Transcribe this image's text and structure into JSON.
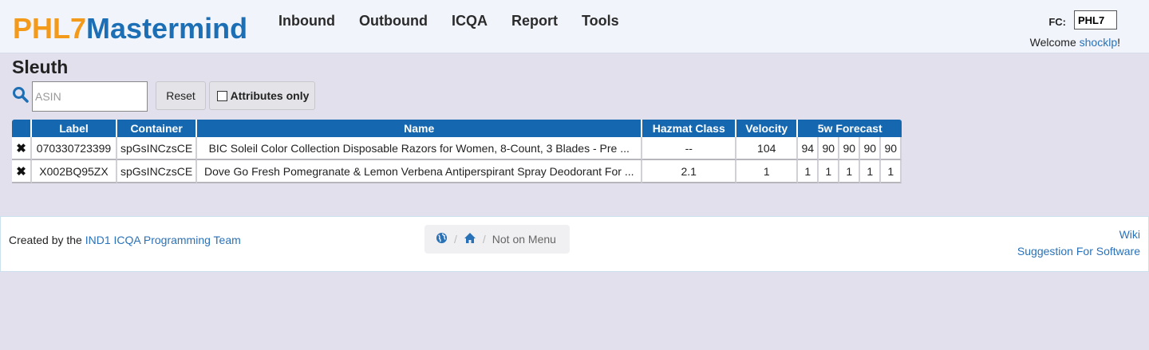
{
  "brand": {
    "part1": "PHL7",
    "part2": "Mastermind"
  },
  "nav": [
    "Inbound",
    "Outbound",
    "ICQA",
    "Report",
    "Tools"
  ],
  "fc": {
    "label": "FC:",
    "value": "PHL7"
  },
  "welcome": {
    "prefix": "Welcome ",
    "user": "shocklp",
    "suffix": "!"
  },
  "page_title": "Sleuth",
  "search": {
    "placeholder": "ASIN",
    "reset_label": "Reset",
    "attributes_label": "Attributes only"
  },
  "table": {
    "headers": {
      "label": "Label",
      "container": "Container",
      "name": "Name",
      "hazmat": "Hazmat Class",
      "velocity": "Velocity",
      "forecast": "5w Forecast"
    },
    "rows": [
      {
        "label": "070330723399",
        "container": "spGsINCzsCE",
        "name": "BIC Soleil Color Collection Disposable Razors for Women, 8-Count, 3 Blades - Pre ...",
        "hazmat": "--",
        "velocity": "104",
        "forecast": [
          "94",
          "90",
          "90",
          "90",
          "90"
        ]
      },
      {
        "label": "X002BQ95ZX",
        "container": "spGsINCzsCE",
        "name": "Dove Go Fresh Pomegranate & Lemon Verbena Antiperspirant Spray Deodorant For ...",
        "hazmat": "2.1",
        "velocity": "1",
        "forecast": [
          "1",
          "1",
          "1",
          "1",
          "1"
        ]
      }
    ]
  },
  "footer": {
    "credit_prefix": "Created by the ",
    "credit_link": "IND1 ICQA Programming Team",
    "breadcrumb_current": "Not on Menu",
    "links": [
      "Wiki",
      "Suggestion For Software"
    ]
  },
  "colors": {
    "brand_orange": "#f39a1b",
    "brand_blue": "#1d6fb5",
    "table_header": "#1568b0",
    "link": "#2a72b8"
  }
}
